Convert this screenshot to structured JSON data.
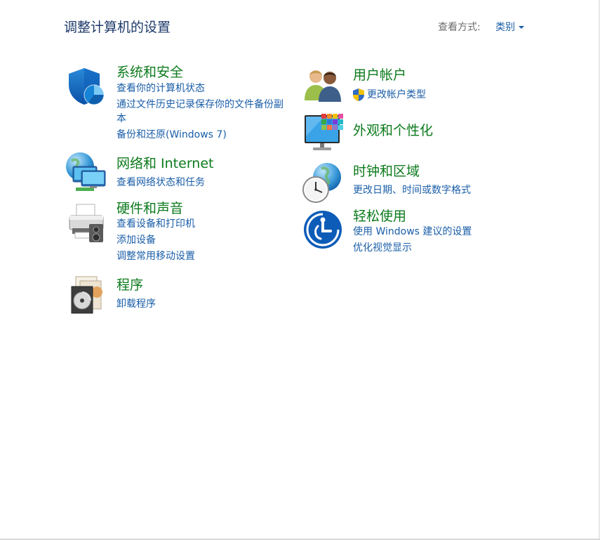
{
  "header": {
    "title": "调整计算机的设置",
    "view_by_label": "查看方式:",
    "view_by_value": "类别"
  },
  "categories": [
    {
      "icon": "security-shield-icon",
      "title": "系统和安全",
      "links": [
        "查看你的计算机状态",
        "通过文件历史记录保存你的文件备份副本",
        "备份和还原(Windows 7)"
      ]
    },
    {
      "icon": "network-globe-icon",
      "title": "网络和 Internet",
      "links": [
        "查看网络状态和任务"
      ]
    },
    {
      "icon": "printer-icon",
      "title": "硬件和声音",
      "links": [
        "查看设备和打印机",
        "添加设备",
        "调整常用移动设置"
      ]
    },
    {
      "icon": "programs-disc-icon",
      "title": "程序",
      "links": [
        "卸载程序"
      ]
    },
    {
      "icon": "user-accounts-icon",
      "title": "用户帐户",
      "links": [
        "更改帐户类型"
      ],
      "link_icon": "uac-shield-icon"
    },
    {
      "icon": "appearance-monitor-icon",
      "title": "外观和个性化",
      "links": []
    },
    {
      "icon": "clock-globe-icon",
      "title": "时钟和区域",
      "links": [
        "更改日期、时间或数字格式"
      ]
    },
    {
      "icon": "ease-of-access-icon",
      "title": "轻松使用",
      "links": [
        "使用 Windows 建议的设置",
        "优化视觉显示"
      ]
    }
  ],
  "colors": {
    "title_text": "#1e3a6a",
    "category_title": "#0c7a1c",
    "link": "#1a5ea8",
    "muted": "#6d6d6d"
  }
}
